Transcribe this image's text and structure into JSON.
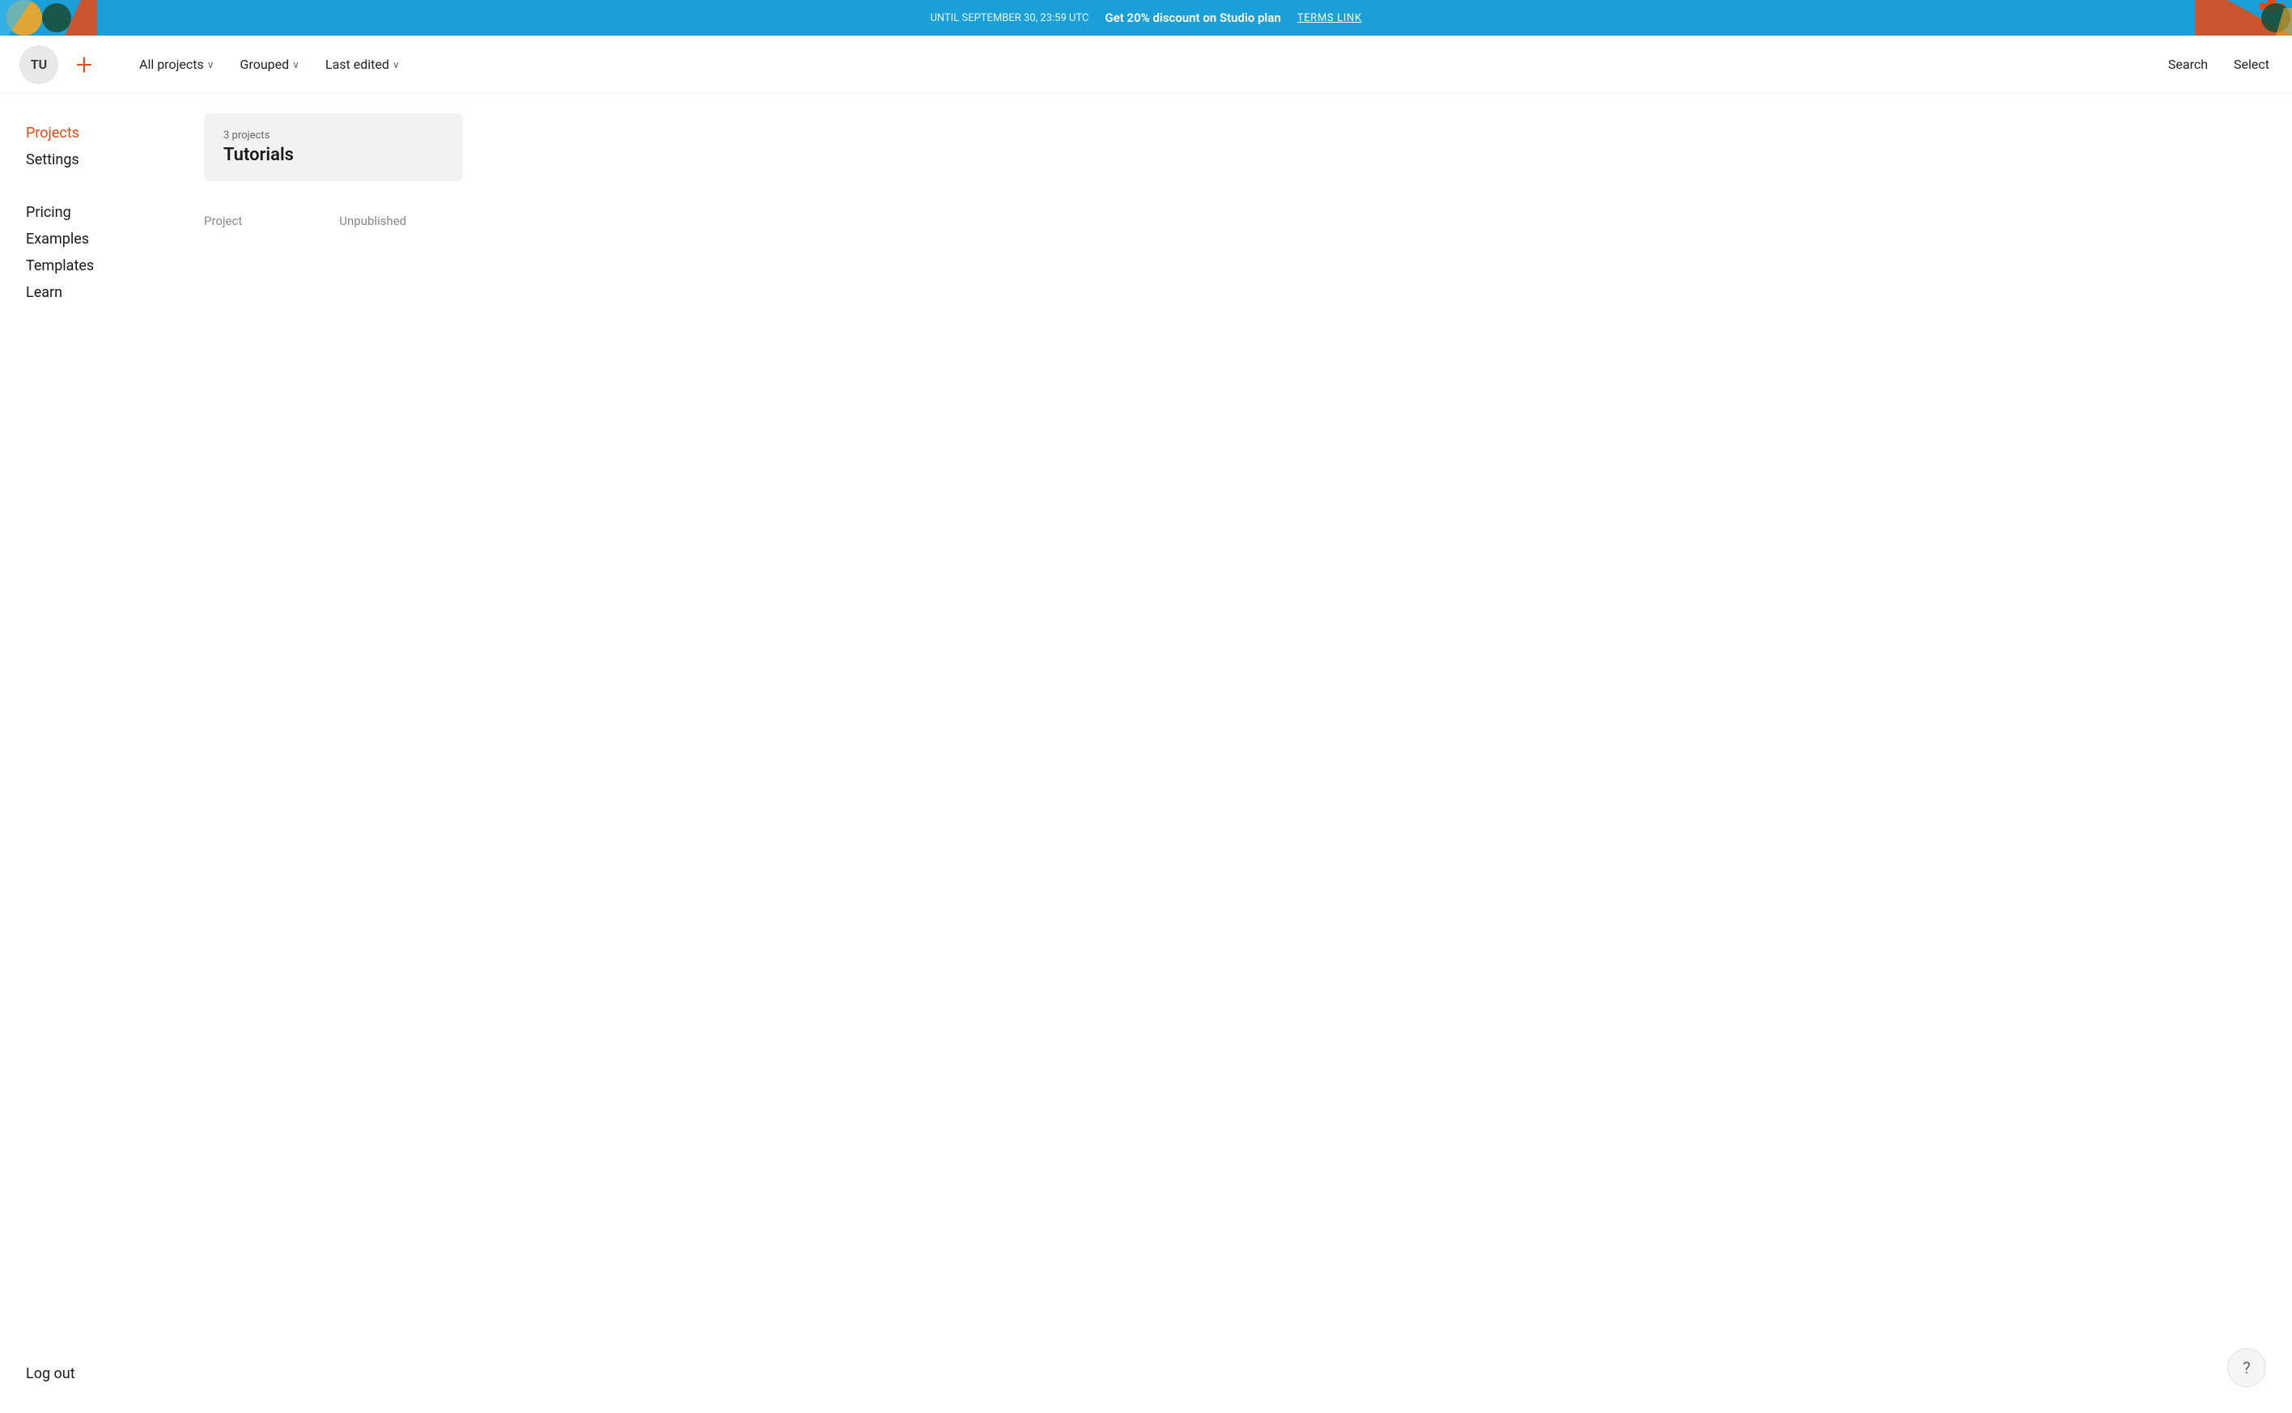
{
  "promoBanner": {
    "until": "UNTIL SEPTEMBER 30, 23:59 UTC",
    "main": "Get 20% discount on Studio plan",
    "terms": "TERMS LINK"
  },
  "header": {
    "avatarText": "TU",
    "newProjectLabel": "+",
    "nav": [
      {
        "label": "All projects",
        "chevron": "∨",
        "id": "all-projects"
      },
      {
        "label": "Grouped",
        "chevron": "∨",
        "id": "grouped"
      },
      {
        "label": "Last edited",
        "chevron": "∨",
        "id": "last-edited"
      }
    ],
    "actions": [
      {
        "label": "Search",
        "id": "search"
      },
      {
        "label": "Select",
        "id": "select"
      }
    ]
  },
  "sidebar": {
    "items": [
      {
        "label": "Projects",
        "id": "projects",
        "active": true
      },
      {
        "label": "Settings",
        "id": "settings",
        "active": false
      }
    ],
    "links": [
      {
        "label": "Pricing",
        "id": "pricing"
      },
      {
        "label": "Examples",
        "id": "examples"
      },
      {
        "label": "Templates",
        "id": "templates"
      },
      {
        "label": "Learn",
        "id": "learn"
      }
    ],
    "logout": "Log out"
  },
  "main": {
    "groupCard": {
      "count": "3 projects",
      "name": "Tutorials"
    },
    "projectListCols": [
      {
        "label": "Project"
      },
      {
        "label": "Unpublished"
      }
    ]
  },
  "help": {
    "icon": "?"
  }
}
